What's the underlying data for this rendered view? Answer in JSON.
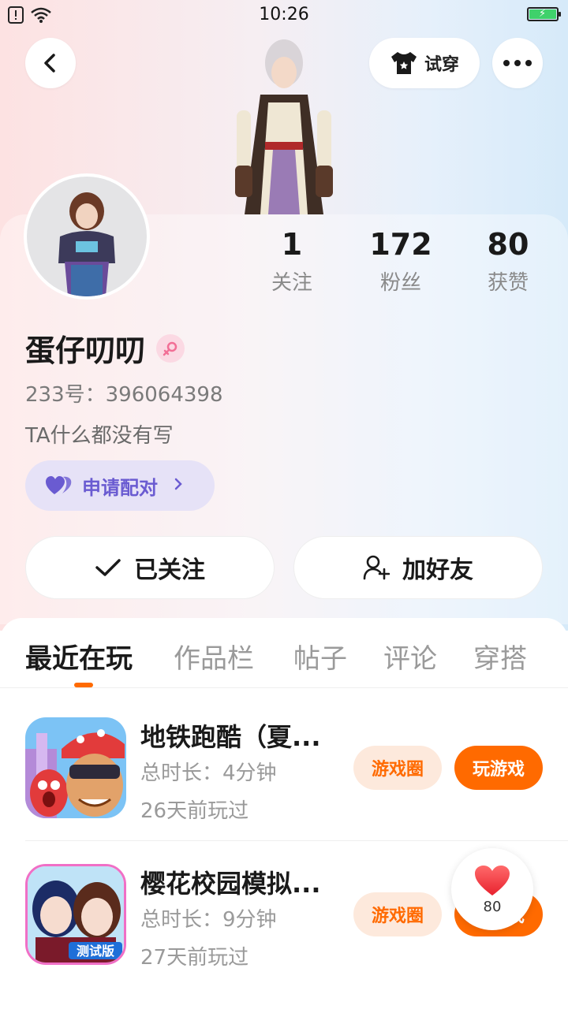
{
  "status_bar": {
    "time": "10:26"
  },
  "header": {
    "tryon_label": "试穿"
  },
  "stats": [
    {
      "value": "1",
      "label": "关注"
    },
    {
      "value": "172",
      "label": "粉丝"
    },
    {
      "value": "80",
      "label": "获赞"
    }
  ],
  "profile": {
    "name": "蛋仔叨叨",
    "uid": "233号：396064398",
    "bio": "TA什么都没有写",
    "pair_label": "申请配对"
  },
  "actions": {
    "follow_label": "已关注",
    "friend_label": "加好友"
  },
  "tabs": [
    {
      "label": "最近在玩",
      "active": true
    },
    {
      "label": "作品栏",
      "active": false
    },
    {
      "label": "帖子",
      "active": false
    },
    {
      "label": "评论",
      "active": false
    },
    {
      "label": "穿搭",
      "active": false
    }
  ],
  "games": [
    {
      "title": "地铁跑酷（夏...",
      "duration": "总时长：4分钟",
      "last_played": "26天前玩过",
      "circle_label": "游戏圈",
      "play_label": "玩游戏"
    },
    {
      "title": "樱花校园模拟...",
      "duration": "总时长：9分钟",
      "last_played": "27天前玩过",
      "circle_label": "游戏圈",
      "play_label": "玩游戏",
      "badge": "测试版"
    }
  ],
  "like_float": {
    "count": "80"
  },
  "colors": {
    "accent": "#ff6a00",
    "pair": "#6a5bd1",
    "battery": "#3fd16b"
  }
}
